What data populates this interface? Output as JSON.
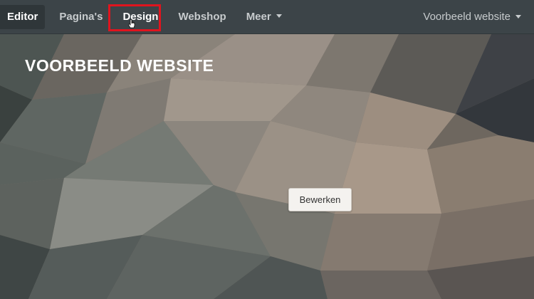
{
  "nav": {
    "editor_label": "Editor",
    "pages_label": "Pagina's",
    "design_label": "Design",
    "webshop_label": "Webshop",
    "more_label": "Meer",
    "site_select_label": "Voorbeeld website"
  },
  "hero": {
    "site_title": "VOORBEELD WEBSITE",
    "edit_button_label": "Bewerken"
  },
  "colors": {
    "topbar": "#3c4448",
    "highlight": "#e0141e"
  }
}
